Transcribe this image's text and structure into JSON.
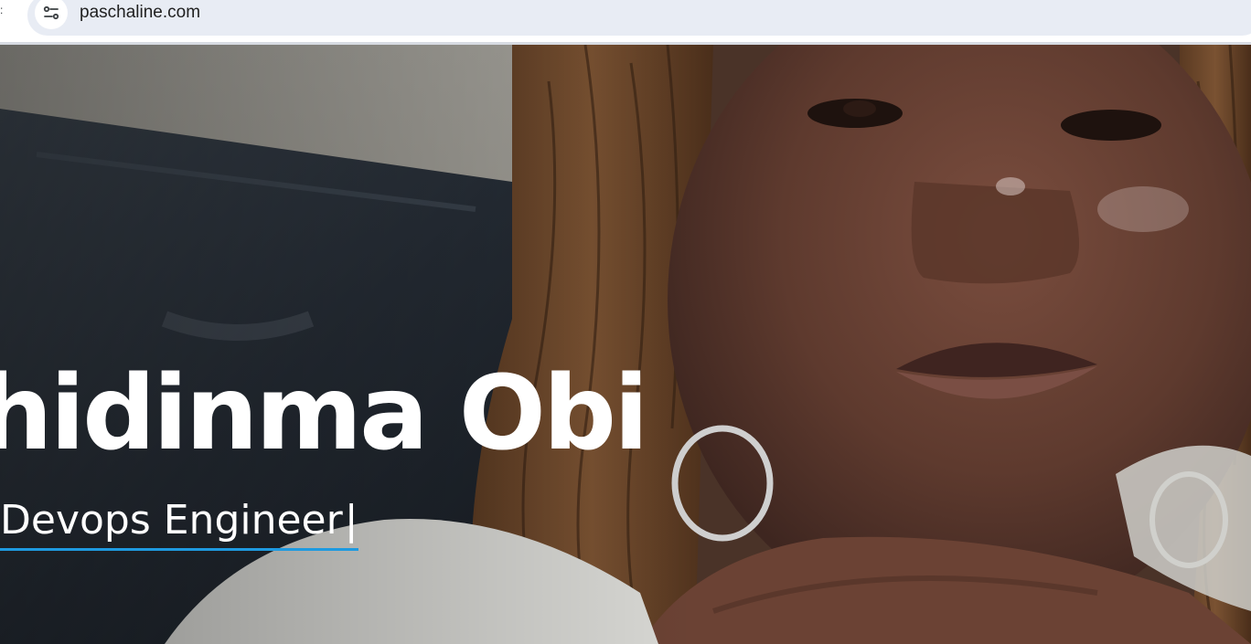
{
  "browser": {
    "url": "paschaline.com",
    "site_info_icon": "tune-icon"
  },
  "hero": {
    "name": "hidinma Obi",
    "role": "Devops Engineer",
    "cursor": "|"
  },
  "colors": {
    "underline": "#1e9ae0",
    "text": "#ffffff",
    "omnibox": "#e8ecf4"
  }
}
